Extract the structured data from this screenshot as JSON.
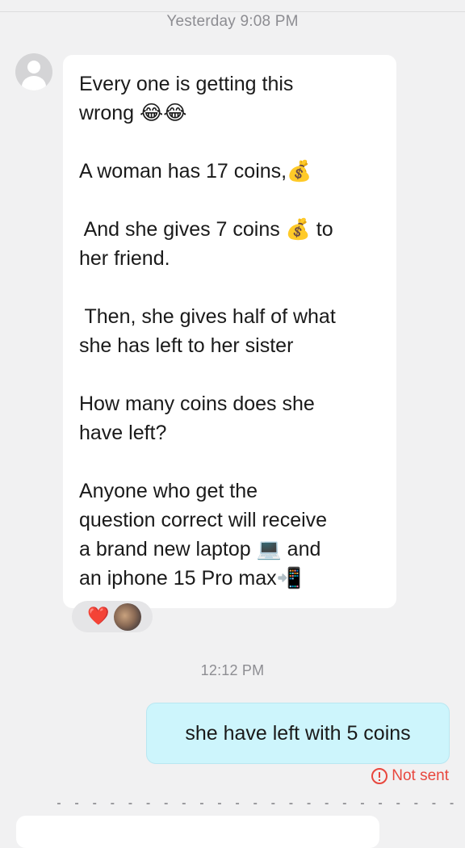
{
  "timestamps": {
    "first": "Yesterday 9:08 PM",
    "second": "12:12 PM"
  },
  "incoming_message": {
    "lines": [
      "Every one is getting this",
      "wrong 😂😂",
      "",
      "A woman has 17 coins,💰",
      "",
      " And she gives 7 coins 💰 to",
      "her friend.",
      "",
      " Then, she gives half of what",
      "she has left to her sister",
      "",
      "How many coins does she",
      "have left?",
      "",
      "Anyone who get the",
      "question correct will receive",
      "a brand new laptop 💻 and",
      "an iphone 15 Pro max📲"
    ],
    "reactions": [
      "❤️"
    ]
  },
  "outgoing_message": {
    "text": "she have left with 5 coins",
    "status": "Not sent",
    "status_icon": "alert-circle-icon"
  },
  "icons": {
    "avatar": "default-user-avatar-icon",
    "reaction_avatar": "user-photo-avatar"
  },
  "colors": {
    "background": "#f1f1f2",
    "incoming_bubble": "#ffffff",
    "outgoing_bubble": "#cdf5fc",
    "error": "#e8473e",
    "timestamp": "#8d8d92"
  }
}
